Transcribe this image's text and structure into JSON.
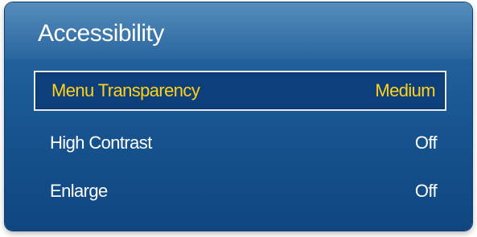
{
  "panel": {
    "title": "Accessibility"
  },
  "menu": {
    "items": [
      {
        "label": "Menu Transparency",
        "value": "Medium",
        "selected": true
      },
      {
        "label": "High Contrast",
        "value": "Off",
        "selected": false
      },
      {
        "label": "Enlarge",
        "value": "Off",
        "selected": false
      }
    ]
  },
  "colors": {
    "panel_background": "#1a5792",
    "selected_background": "#0d3f7a",
    "selected_text": "#ffd21a",
    "normal_text": "#ffffff",
    "selected_border": "#e8edf3"
  }
}
